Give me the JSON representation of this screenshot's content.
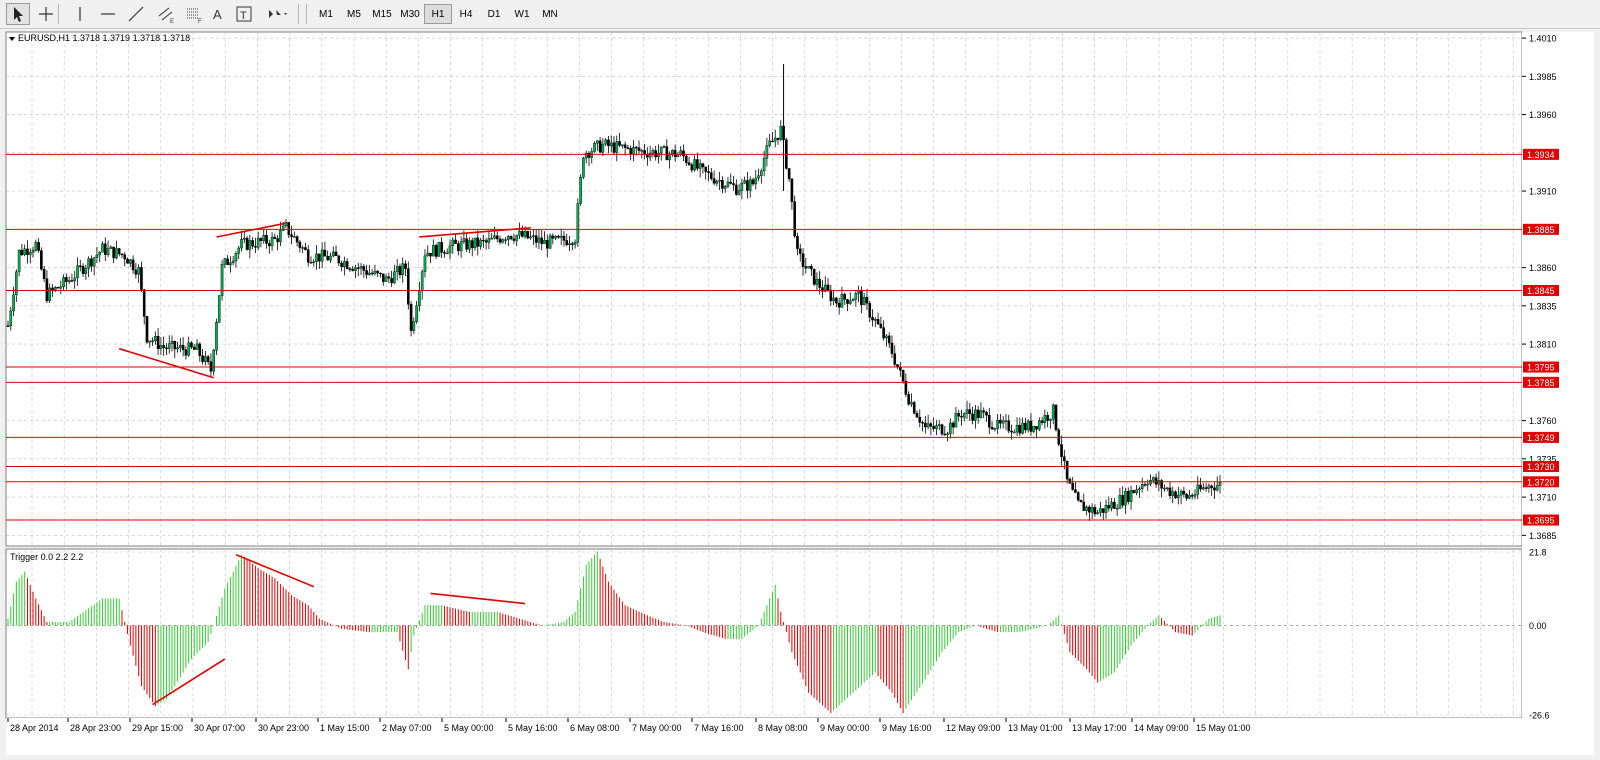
{
  "toolbar": {
    "tools": [
      {
        "name": "cursor-tool-icon",
        "label": "Cursor"
      },
      {
        "name": "crosshair-tool-icon",
        "label": "Crosshair"
      },
      {
        "name": "vertical-line-tool-icon",
        "label": "Vertical Line"
      },
      {
        "name": "horizontal-line-tool-icon",
        "label": "Horizontal Line"
      },
      {
        "name": "trendline-tool-icon",
        "label": "Trendline"
      },
      {
        "name": "equidistant-channel-tool-icon",
        "label": "Equidistant Channel"
      },
      {
        "name": "fibonacci-tool-icon",
        "label": "Fibonacci Retracement"
      },
      {
        "name": "text-tool-icon",
        "label": "A"
      },
      {
        "name": "text-label-tool-icon",
        "label": "T"
      },
      {
        "name": "arrows-tool-icon",
        "label": "Arrows"
      }
    ],
    "timeframes": [
      "M1",
      "M5",
      "M15",
      "M30",
      "H1",
      "H4",
      "D1",
      "W1",
      "MN"
    ],
    "active_timeframe": "H1"
  },
  "chart": {
    "header": "EURUSD,H1  1.3718 1.3719 1.3718 1.3718",
    "indicator_header": "Trigger 0.0 2.2 2.2",
    "price_ticks": [
      "1.4010",
      "1.3985",
      "1.3960",
      "1.3910",
      "1.3860",
      "1.3835",
      "1.3810",
      "1.3760",
      "1.3735",
      "1.3710",
      "1.3685"
    ],
    "level_labels": [
      "1.3934",
      "1.3885",
      "1.3845",
      "1.3795",
      "1.3785",
      "1.3749",
      "1.3730",
      "1.3720",
      "1.3695"
    ],
    "indicator_ticks": [
      "21.8",
      "0.00",
      "-26.6"
    ],
    "time_labels": [
      "28 Apr 2014",
      "28 Apr 23:00",
      "29 Apr 15:00",
      "30 Apr 07:00",
      "30 Apr 23:00",
      "1 May 15:00",
      "2 May 07:00",
      "5 May 00:00",
      "5 May 16:00",
      "6 May 08:00",
      "7 May 00:00",
      "7 May 16:00",
      "8 May 08:00",
      "9 May 00:00",
      "9 May 16:00",
      "12 May 09:00",
      "13 May 01:00",
      "13 May 17:00",
      "14 May 09:00",
      "15 May 01:00"
    ]
  },
  "colors": {
    "background": "#ffffff",
    "grid": "#c0c0c0",
    "level_line": "#e00000",
    "bull_candle": "#00b050",
    "bear_candle": "#000000",
    "hist_up": "#33cc33",
    "hist_down": "#e00000"
  },
  "chart_data": {
    "type": "candlestick",
    "symbol": "EURUSD",
    "timeframe": "H1",
    "ylim": [
      1.368,
      1.4012
    ],
    "levels": [
      1.3934,
      1.3885,
      1.3845,
      1.3795,
      1.3785,
      1.3749,
      1.373,
      1.372,
      1.3695
    ],
    "close_path": [
      [
        0,
        1.3822
      ],
      [
        4,
        1.387
      ],
      [
        10,
        1.3875
      ],
      [
        14,
        1.3842
      ],
      [
        22,
        1.3852
      ],
      [
        34,
        1.3872
      ],
      [
        42,
        1.3868
      ],
      [
        47,
        1.3858
      ],
      [
        50,
        1.3815
      ],
      [
        56,
        1.3808
      ],
      [
        68,
        1.3806
      ],
      [
        73,
        1.3793
      ],
      [
        77,
        1.386
      ],
      [
        84,
        1.3875
      ],
      [
        96,
        1.3878
      ],
      [
        100,
        1.3886
      ],
      [
        108,
        1.3868
      ],
      [
        118,
        1.3866
      ],
      [
        126,
        1.386
      ],
      [
        136,
        1.3852
      ],
      [
        143,
        1.386
      ],
      [
        145,
        1.3818
      ],
      [
        150,
        1.387
      ],
      [
        160,
        1.3874
      ],
      [
        172,
        1.3876
      ],
      [
        180,
        1.3882
      ],
      [
        186,
        1.388
      ],
      [
        193,
        1.3876
      ],
      [
        198,
        1.3877
      ],
      [
        204,
        1.388
      ],
      [
        207,
        1.3935
      ],
      [
        214,
        1.394
      ],
      [
        228,
        1.3936
      ],
      [
        242,
        1.3934
      ],
      [
        250,
        1.3922
      ],
      [
        262,
        1.3912
      ],
      [
        268,
        1.3915
      ],
      [
        274,
        1.394
      ],
      [
        278,
        1.395
      ],
      [
        281,
        1.3918
      ],
      [
        284,
        1.3868
      ],
      [
        291,
        1.385
      ],
      [
        298,
        1.3838
      ],
      [
        306,
        1.3842
      ],
      [
        312,
        1.3825
      ],
      [
        318,
        1.3805
      ],
      [
        324,
        1.3775
      ],
      [
        330,
        1.3755
      ],
      [
        338,
        1.3755
      ],
      [
        343,
        1.3765
      ],
      [
        350,
        1.3764
      ],
      [
        356,
        1.3756
      ],
      [
        368,
        1.3756
      ],
      [
        376,
        1.3766
      ],
      [
        381,
        1.372
      ],
      [
        385,
        1.3705
      ],
      [
        392,
        1.37
      ],
      [
        402,
        1.371
      ],
      [
        410,
        1.3722
      ],
      [
        418,
        1.3714
      ],
      [
        424,
        1.371
      ],
      [
        433,
        1.3718
      ]
    ],
    "indicator": {
      "name": "Trigger",
      "params": [
        0.0,
        2.2,
        2.2
      ],
      "ylim": [
        -26.6,
        21.8
      ],
      "path": [
        [
          0,
          2
        ],
        [
          3,
          13
        ],
        [
          6,
          16
        ],
        [
          10,
          8
        ],
        [
          14,
          1
        ],
        [
          22,
          1
        ],
        [
          34,
          8
        ],
        [
          40,
          8
        ],
        [
          44,
          -6
        ],
        [
          48,
          -18
        ],
        [
          53,
          -24
        ],
        [
          57,
          -22
        ],
        [
          66,
          -10
        ],
        [
          72,
          -5
        ],
        [
          74,
          0
        ],
        [
          78,
          11
        ],
        [
          84,
          21
        ],
        [
          90,
          17
        ],
        [
          96,
          14
        ],
        [
          102,
          9
        ],
        [
          108,
          6
        ],
        [
          112,
          2
        ],
        [
          120,
          -1
        ],
        [
          130,
          -2
        ],
        [
          140,
          -2
        ],
        [
          144,
          -13
        ],
        [
          146,
          -3
        ],
        [
          150,
          6
        ],
        [
          156,
          6
        ],
        [
          166,
          4
        ],
        [
          176,
          4
        ],
        [
          184,
          2
        ],
        [
          192,
          0
        ],
        [
          200,
          1
        ],
        [
          204,
          4
        ],
        [
          208,
          18
        ],
        [
          212,
          22
        ],
        [
          216,
          13
        ],
        [
          222,
          6
        ],
        [
          230,
          3
        ],
        [
          236,
          1
        ],
        [
          244,
          0
        ],
        [
          250,
          -2
        ],
        [
          258,
          -4
        ],
        [
          264,
          -4
        ],
        [
          270,
          0
        ],
        [
          274,
          8
        ],
        [
          276,
          12
        ],
        [
          278,
          4
        ],
        [
          282,
          -8
        ],
        [
          288,
          -20
        ],
        [
          296,
          -26
        ],
        [
          304,
          -20
        ],
        [
          312,
          -14
        ],
        [
          318,
          -20
        ],
        [
          322,
          -26
        ],
        [
          330,
          -16
        ],
        [
          336,
          -8
        ],
        [
          342,
          -2
        ],
        [
          348,
          0
        ],
        [
          356,
          -2
        ],
        [
          364,
          -2
        ],
        [
          374,
          0
        ],
        [
          378,
          3
        ],
        [
          382,
          -8
        ],
        [
          388,
          -13
        ],
        [
          392,
          -17
        ],
        [
          398,
          -14
        ],
        [
          404,
          -6
        ],
        [
          410,
          0
        ],
        [
          414,
          3
        ],
        [
          420,
          -2
        ],
        [
          426,
          -3
        ],
        [
          432,
          2
        ],
        [
          436,
          3
        ]
      ]
    }
  }
}
